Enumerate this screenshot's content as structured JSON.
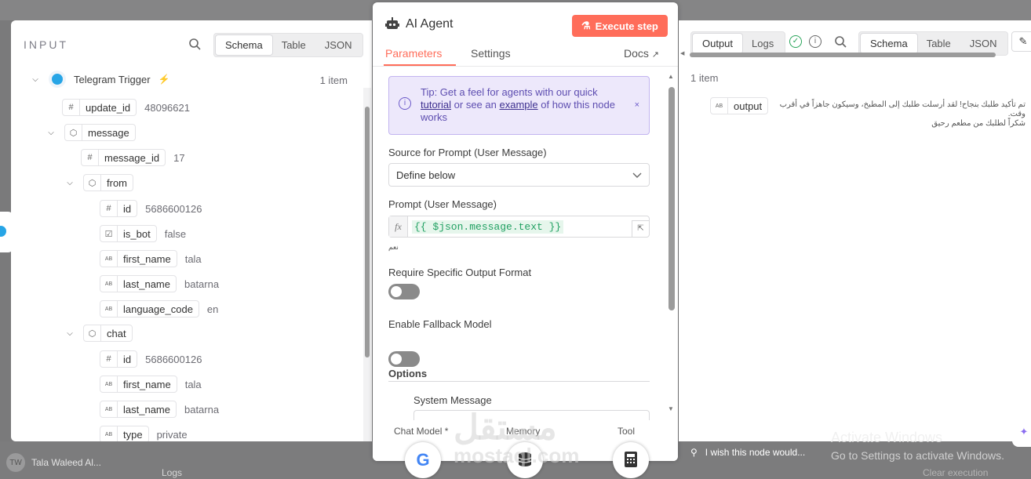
{
  "background": {
    "user_name": "Tala Waleed Al...",
    "user_initials": "TW",
    "logs_label": "Logs",
    "clear_label": "Clear execution",
    "notice": "I wish this node would...",
    "activate_title": "Activate Windows",
    "activate_sub": "Go to Settings to activate Windows."
  },
  "input": {
    "label": "INPUT",
    "tabs": [
      "Schema",
      "Table",
      "JSON"
    ],
    "trigger_name": "Telegram Trigger",
    "item_count": "1 item",
    "fields": {
      "update_id": {
        "name": "update_id",
        "value": "48096621"
      },
      "message": {
        "name": "message"
      },
      "message_id": {
        "name": "message_id",
        "value": "17"
      },
      "from": {
        "name": "from"
      },
      "from_id": {
        "name": "id",
        "value": "5686600126"
      },
      "is_bot": {
        "name": "is_bot",
        "value": "false"
      },
      "first_name": {
        "name": "first_name",
        "value": "tala"
      },
      "last_name": {
        "name": "last_name",
        "value": "batarna"
      },
      "language_code": {
        "name": "language_code",
        "value": "en"
      },
      "chat": {
        "name": "chat"
      },
      "chat_id": {
        "name": "id",
        "value": "5686600126"
      },
      "chat_first_name": {
        "name": "first_name",
        "value": "tala"
      },
      "chat_last_name": {
        "name": "last_name",
        "value": "batarna"
      },
      "chat_type": {
        "name": "type",
        "value": "private"
      }
    }
  },
  "agent": {
    "title": "AI Agent",
    "execute_label": "Execute step",
    "tabs": {
      "parameters": "Parameters",
      "settings": "Settings",
      "docs": "Docs"
    },
    "tip": {
      "lead": "Tip: Get a feel for agents with our quick",
      "link1": "tutorial",
      "mid": "or see an",
      "link2": "example",
      "tail": "of how this node works"
    },
    "source_label": "Source for Prompt (User Message)",
    "source_value": "Define below",
    "prompt_label": "Prompt (User Message)",
    "prompt_expression": "{{ $json.message.text }}",
    "prompt_preview": "نعم",
    "require_format_label": "Require Specific Output Format",
    "fallback_label": "Enable Fallback Model",
    "options_label": "Options",
    "system_message_label": "System Message",
    "subnodes": {
      "chat_model": "Chat Model *",
      "memory": "Memory",
      "tool": "Tool"
    }
  },
  "output": {
    "tabs": [
      "Output",
      "Logs"
    ],
    "view_tabs": [
      "Schema",
      "Table",
      "JSON"
    ],
    "item_count": "1 item",
    "field_name": "output",
    "field_value_line1": "تم تأكيد طلبك بنجاح! لقد أرسلت طلبك إلى المطبخ، وسيكون جاهزاً في أقرب وقت.",
    "field_value_line2": "شكراً لطلبك من مطعم رحيق"
  },
  "watermark": {
    "ar": "مستقل",
    "en": "mostaql.com"
  },
  "colors": {
    "accent": "#ff6d5a",
    "success": "#29a55a",
    "telegram": "#27a5e6",
    "tip_bg": "#ede8fb"
  }
}
